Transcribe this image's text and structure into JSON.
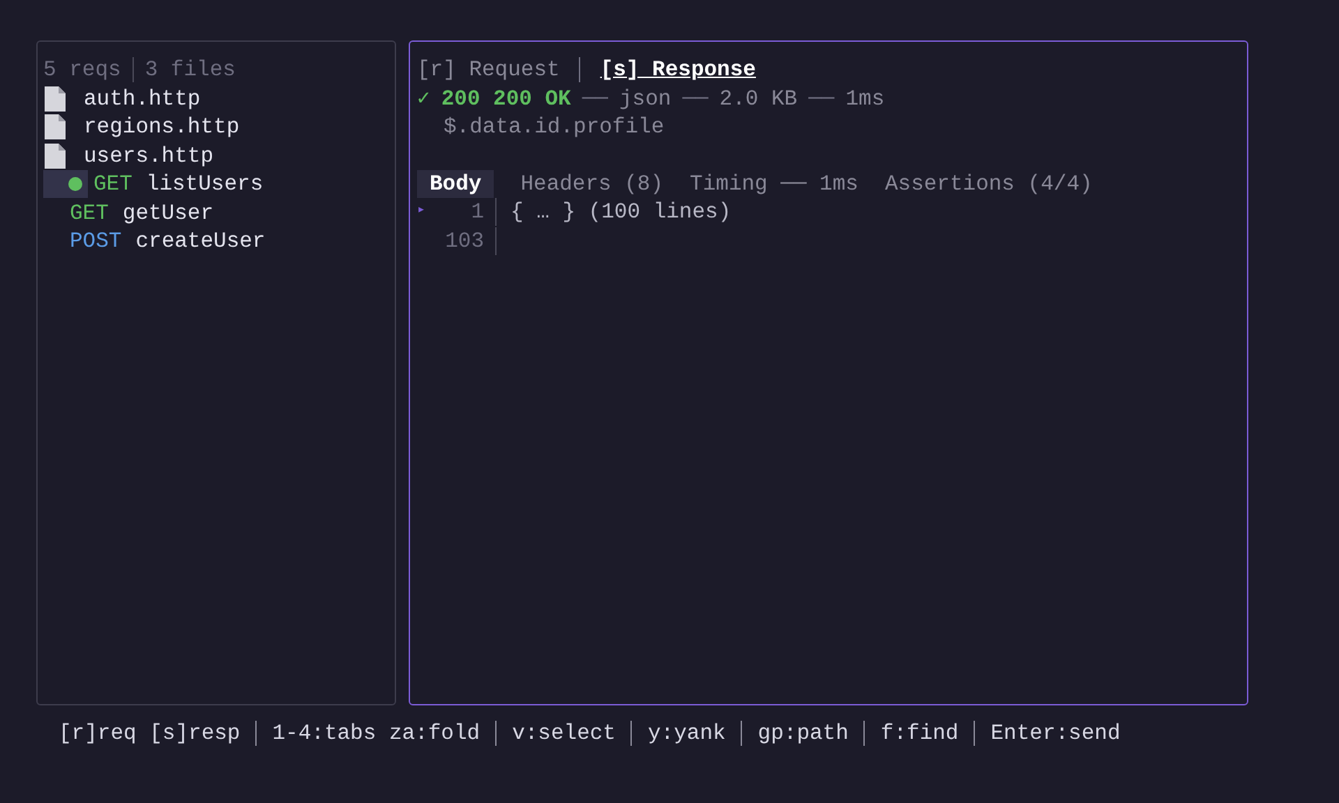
{
  "sidebar": {
    "summary": {
      "requests": "5 reqs",
      "files": "3 files"
    },
    "tree": [
      {
        "name": "auth.http",
        "kind": "file"
      },
      {
        "name": "regions.http",
        "kind": "file"
      },
      {
        "name": "users.http",
        "kind": "file",
        "children": [
          {
            "method": "GET",
            "name": "listUsers",
            "color": "#5fbf5f",
            "selected": true
          },
          {
            "method": "GET",
            "name": "getUser",
            "color": "#5fbf5f",
            "selected": false
          },
          {
            "method": "POST",
            "name": "createUser",
            "color": "#5b9ce6",
            "selected": false
          }
        ]
      }
    ]
  },
  "panel": {
    "tabs": [
      {
        "label": "[r] Request",
        "selected": false
      },
      {
        "label": "[s] Response",
        "selected": true
      }
    ],
    "status": {
      "check": "✓",
      "code": "200 200 OK",
      "details": [
        "json",
        "2.0 KB",
        "1ms"
      ],
      "separator": "──"
    },
    "path": "$.data.id.profile",
    "subtabs": [
      {
        "label": "Body",
        "selected": true
      },
      {
        "label": "Headers (8)",
        "selected": false
      },
      {
        "label": "Timing ── 1ms",
        "selected": false
      },
      {
        "label": "Assertions (4/4)",
        "selected": false
      }
    ],
    "lines": [
      {
        "marker": "▸",
        "number": "1",
        "text": "{ … } (100 lines)"
      },
      {
        "number": "103"
      }
    ]
  },
  "footer": [
    "[r]req [s]resp",
    "1-4:tabs za:fold",
    "v:select",
    "y:yank",
    "gp:path",
    "f:find",
    "Enter:send"
  ]
}
